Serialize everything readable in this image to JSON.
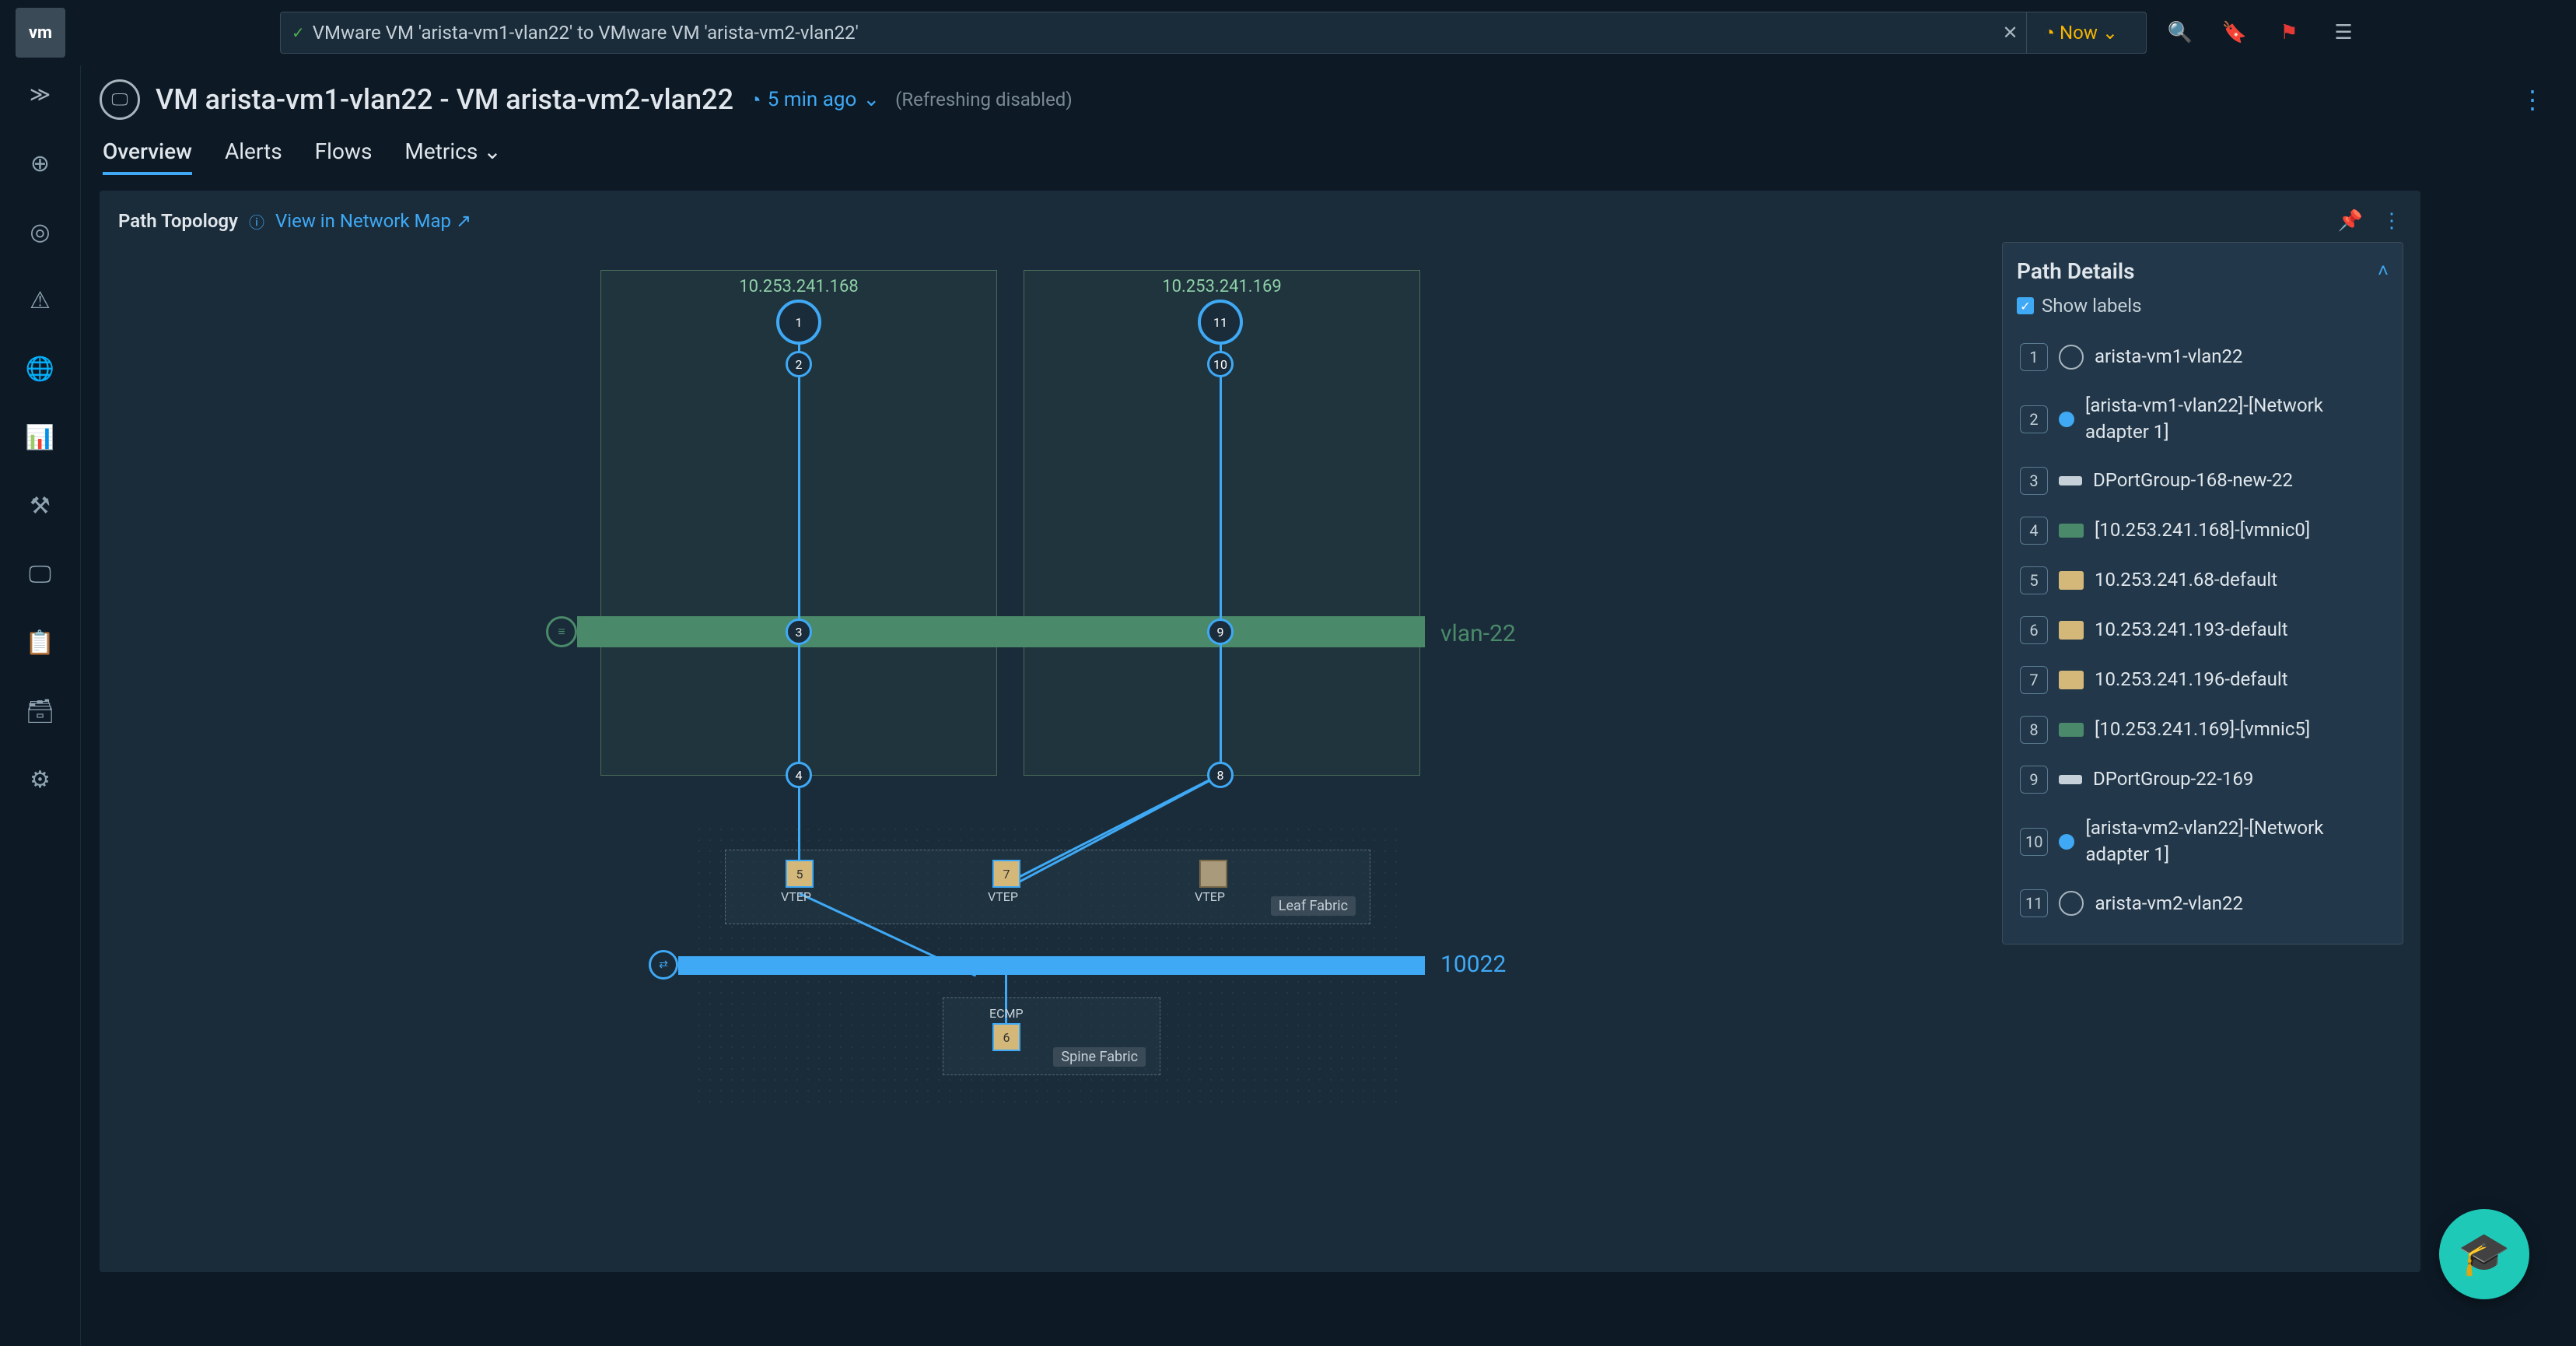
{
  "topbar": {
    "search": "VMware VM 'arista-vm1-vlan22' to VMware VM 'arista-vm2-vlan22'",
    "now": "Now"
  },
  "header": {
    "title": "VM arista-vm1-vlan22 - VM arista-vm2-vlan22",
    "time_ago": "5 min ago",
    "refresh": "(Refreshing disabled)"
  },
  "tabs": {
    "overview": "Overview",
    "alerts": "Alerts",
    "flows": "Flows",
    "metrics": "Metrics"
  },
  "panel": {
    "title": "Path Topology",
    "view_link": "View in Network Map"
  },
  "topo": {
    "host1": "10.253.241.168",
    "host2": "10.253.241.169",
    "vlan": "vlan-22",
    "vxlan": "10022",
    "leaf": "Leaf Fabric",
    "spine": "Spine Fabric",
    "vtep": "VTEP",
    "ecmp": "ECMP",
    "nodes": [
      "1",
      "2",
      "3",
      "4",
      "5",
      "6",
      "7",
      "8",
      "9",
      "10",
      "11"
    ]
  },
  "details": {
    "title": "Path Details",
    "show_labels": "Show labels",
    "items": [
      {
        "n": "1",
        "type": "monitor",
        "label": "arista-vm1-vlan22"
      },
      {
        "n": "2",
        "type": "dot",
        "label": "[arista-vm1-vlan22]-[Network adapter 1]"
      },
      {
        "n": "3",
        "type": "net",
        "label": "DPortGroup-168-new-22"
      },
      {
        "n": "4",
        "type": "nic",
        "label": "[10.253.241.168]-[vmnic0]"
      },
      {
        "n": "5",
        "type": "sw",
        "label": "10.253.241.68-default"
      },
      {
        "n": "6",
        "type": "sw",
        "label": "10.253.241.193-default"
      },
      {
        "n": "7",
        "type": "sw",
        "label": "10.253.241.196-default"
      },
      {
        "n": "8",
        "type": "nic",
        "label": "[10.253.241.169]-[vmnic5]"
      },
      {
        "n": "9",
        "type": "net",
        "label": "DPortGroup-22-169"
      },
      {
        "n": "10",
        "type": "dot",
        "label": "[arista-vm2-vlan22]-[Network adapter 1]"
      },
      {
        "n": "11",
        "type": "monitor",
        "label": "arista-vm2-vlan22"
      }
    ]
  }
}
